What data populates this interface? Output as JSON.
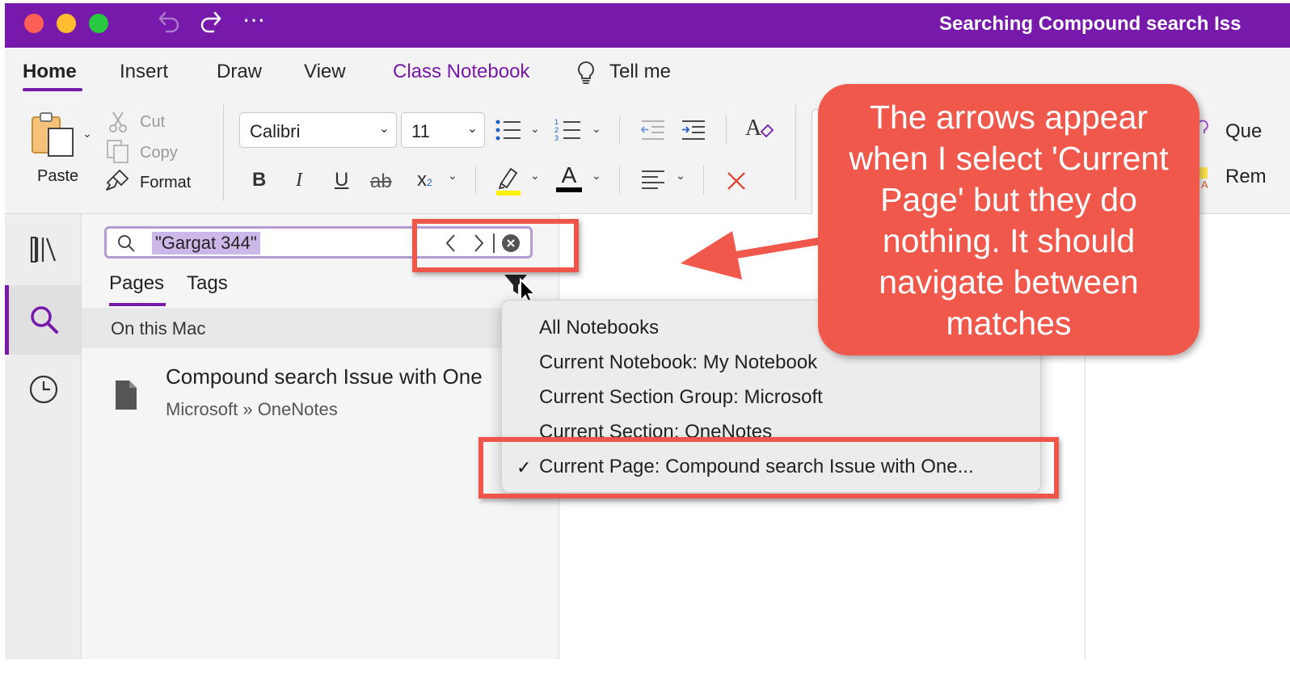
{
  "window": {
    "title": "Searching Compound search Iss",
    "toolbar_more": "⋯"
  },
  "ribbon": {
    "tabs": [
      "Home",
      "Insert",
      "Draw",
      "View",
      "Class Notebook",
      "Tell me"
    ],
    "active_tab": "Home",
    "clipboard": {
      "paste": "Paste",
      "cut": "Cut",
      "copy": "Copy",
      "format": "Format"
    },
    "font": {
      "family": "Calibri",
      "size": "11"
    },
    "format_buttons": {
      "bold": "B",
      "italic": "I",
      "underline": "U",
      "strike": "ab",
      "subscript": "x",
      "subscript_small": "2",
      "font_color": "A"
    },
    "styles_partial": [
      "Que",
      "Rem"
    ]
  },
  "search": {
    "query": "\"Gargat 344\"",
    "tabs": [
      "Pages",
      "Tags"
    ],
    "active_tab": "Pages",
    "group_header": "On this Mac",
    "results": [
      {
        "title": "Compound search Issue with One",
        "path": "Microsoft » OneNotes"
      }
    ]
  },
  "scope_menu": {
    "items": [
      "All Notebooks",
      "Current Notebook: My Notebook",
      "Current Section Group: Microsoft",
      "Current Section: OneNotes",
      "Current Page: Compound search Issue with One..."
    ],
    "selected_index": 4,
    "check_mark": "✓"
  },
  "annotation": {
    "text": "The arrows appear when I select 'Current Page' but they do nothing. It should navigate between matches",
    "color": "#f1584c"
  },
  "colors": {
    "accent": "#7719aa",
    "highlight": "#cbb7e8",
    "annotation_red": "#f0554a"
  }
}
